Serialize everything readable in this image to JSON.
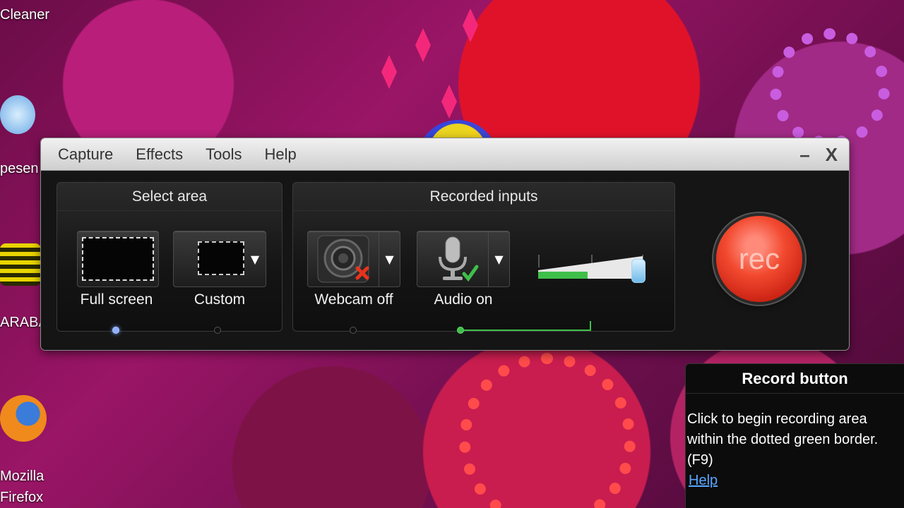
{
  "desktop": {
    "labels": {
      "cleaner": "Cleaner",
      "pesen": "pesen",
      "araba": "ARABA",
      "mozilla": "Mozilla",
      "firefox": "Firefox"
    }
  },
  "recorder": {
    "menu": [
      "Capture",
      "Effects",
      "Tools",
      "Help"
    ],
    "minimize_label": "–",
    "close_label": "X",
    "select_area": {
      "title": "Select area",
      "full_screen": "Full screen",
      "custom": "Custom"
    },
    "recorded_inputs": {
      "title": "Recorded inputs",
      "webcam": "Webcam off",
      "audio": "Audio on",
      "audio_level": 0.47
    },
    "rec_label": "rec"
  },
  "tooltip": {
    "title": "Record button",
    "line1": "Click to begin recording area",
    "line2": "within the dotted green border.",
    "line3": "(F9)",
    "link": "Help"
  },
  "colors": {
    "accent_green": "#3fbf4a",
    "rec_red": "#e8331e",
    "link_blue": "#58a6ff"
  },
  "icons": [
    "webcam-icon",
    "microphone-icon",
    "close-icon",
    "minimize-icon",
    "cursor-icon",
    "firefox-icon"
  ]
}
